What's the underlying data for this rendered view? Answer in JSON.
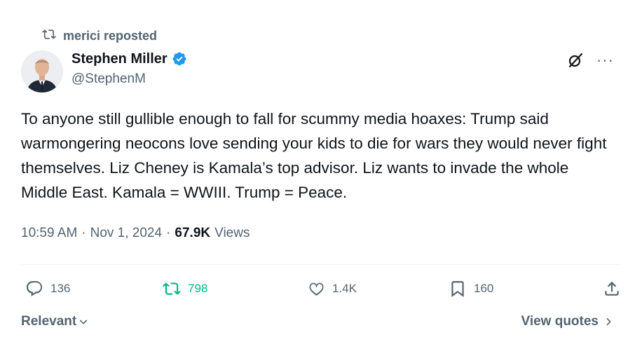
{
  "repost": {
    "text": "merici reposted",
    "icon": "repost-icon"
  },
  "author": {
    "name": "Stephen Miller",
    "handle": "@StephenM",
    "verified_color": "#1d9bf0"
  },
  "tweet": {
    "text": "To anyone still gullible enough to fall for scummy media hoaxes: Trump said warmongering neocons love sending your kids to die for wars they would never fight themselves. Liz Cheney is Kamala’s top advisor. Liz wants to invade the whole Middle East. Kamala = WWIII. Trump = Peace."
  },
  "meta": {
    "time": "10:59 AM",
    "sep1": "·",
    "date": "Nov 1, 2024",
    "sep2": "·",
    "views_count": "67.9K",
    "views_label": "Views"
  },
  "actions": {
    "reply_count": "136",
    "repost_count": "798",
    "like_count": "1.4K",
    "bookmark_count": "160",
    "repost_color": "#00ba7c"
  },
  "footer": {
    "sort_label": "Relevant",
    "view_quotes_label": "View quotes"
  }
}
